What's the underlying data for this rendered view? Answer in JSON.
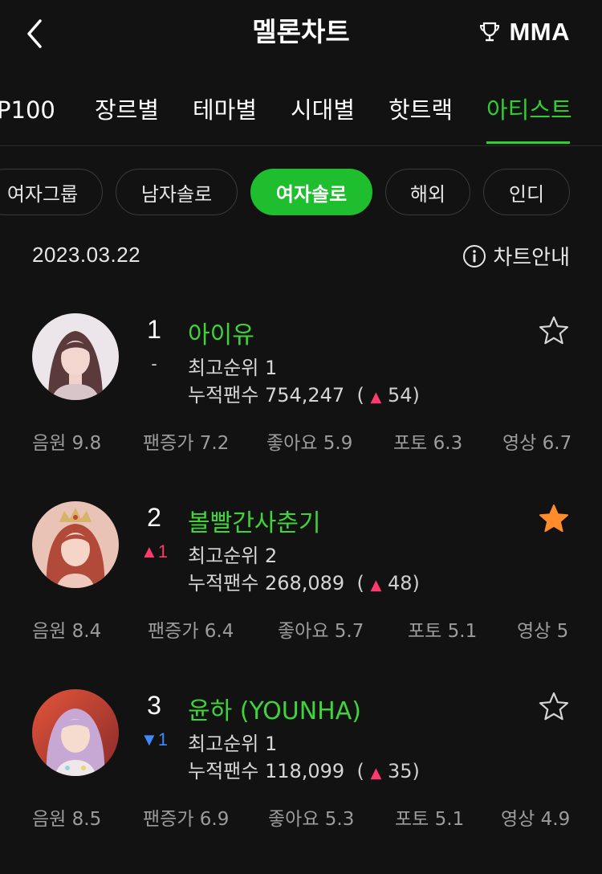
{
  "header": {
    "title": "멜론차트",
    "mma_label": "MMA"
  },
  "tabs": [
    "P100",
    "장르별",
    "테마별",
    "시대별",
    "핫트랙",
    "아티스트"
  ],
  "filters": [
    "여자그룹",
    "남자솔로",
    "여자솔로",
    "해외",
    "인디"
  ],
  "date": "2023.03.22",
  "chart_info_label": "차트안내",
  "artists": [
    {
      "rank": "1",
      "change": "-",
      "name": "아이유",
      "best_rank": "최고순위 1",
      "fans_label": "누적팬수 754,247",
      "fans_open": "(",
      "fans_increase": "54",
      "fans_close": ")",
      "favorited": false,
      "stats": [
        "음원 9.8",
        "팬증가 7.2",
        "좋아요 5.9",
        "포토 6.3",
        "영상 6.7"
      ]
    },
    {
      "rank": "2",
      "change": "1",
      "change_dir": "up",
      "name": "볼빨간사춘기",
      "best_rank": "최고순위 2",
      "fans_label": "누적팬수 268,089",
      "fans_open": "(",
      "fans_increase": "48",
      "fans_close": ")",
      "favorited": true,
      "stats": [
        "음원 8.4",
        "팬증가 6.4",
        "좋아요 5.7",
        "포토 5.1",
        "영상 5"
      ]
    },
    {
      "rank": "3",
      "change": "1",
      "change_dir": "down",
      "name": "윤하 (YOUNHA)",
      "best_rank": "최고순위 1",
      "fans_label": "누적팬수 118,099",
      "fans_open": "(",
      "fans_increase": "35",
      "fans_close": ")",
      "favorited": false,
      "stats": [
        "음원 8.5",
        "팬증가 6.9",
        "좋아요 5.3",
        "포토 5.1",
        "영상 4.9"
      ]
    }
  ],
  "colors": {
    "accent": "#2fd12f",
    "up": "#ff3a6d",
    "down": "#3d8cff",
    "star_active": "#ff8c2b"
  }
}
